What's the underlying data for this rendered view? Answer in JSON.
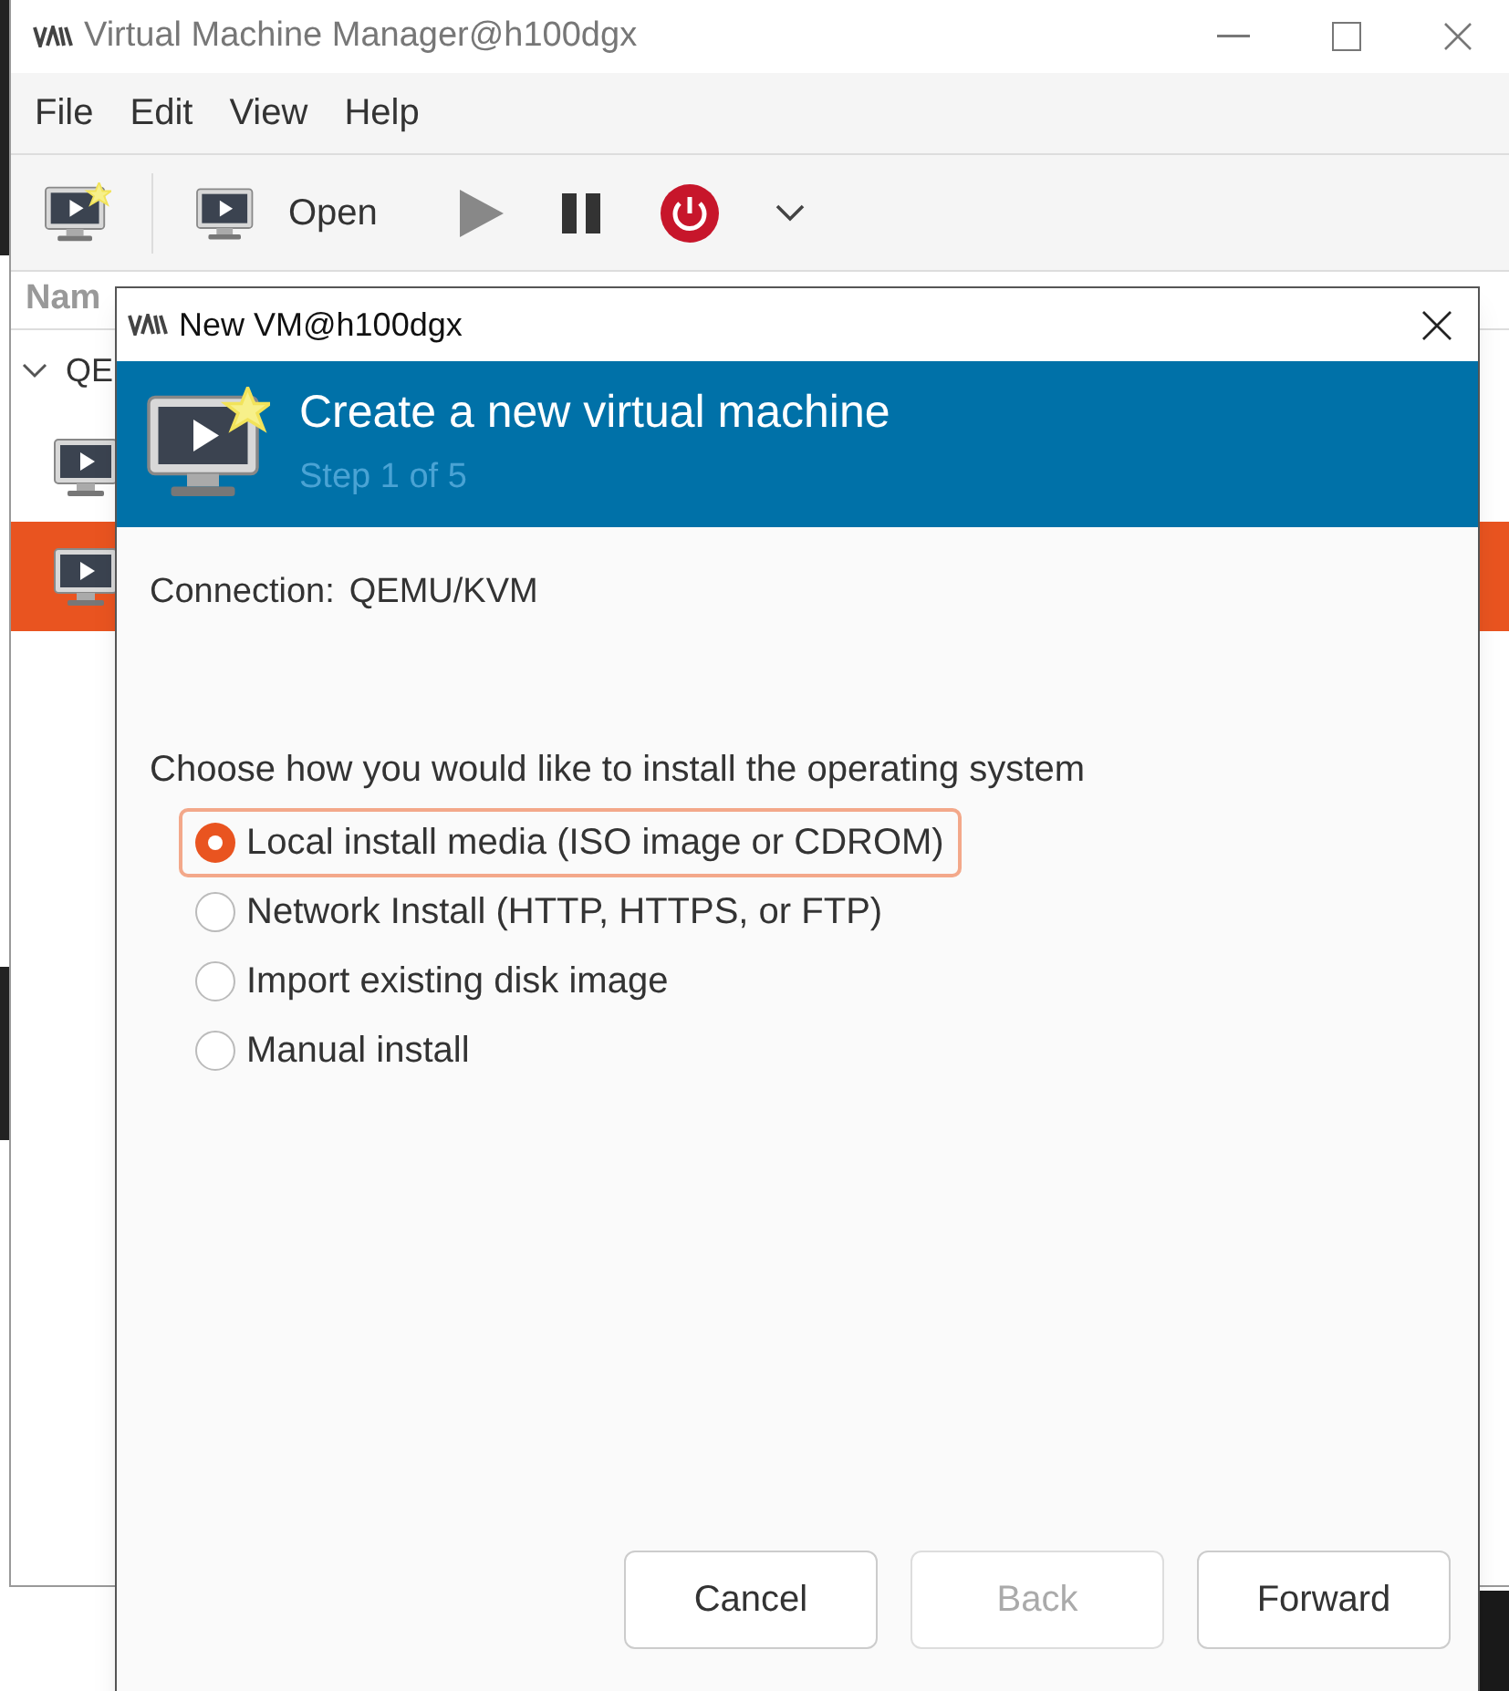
{
  "main_window": {
    "title": "Virtual Machine Manager@h100dgx",
    "menu": [
      "File",
      "Edit",
      "View",
      "Help"
    ],
    "toolbar": {
      "open_label": "Open"
    },
    "list": {
      "column_1": "Nam",
      "group": {
        "label": "QE",
        "expanded": true
      },
      "rows": [
        {
          "selected": false
        },
        {
          "selected": true
        }
      ]
    }
  },
  "dialog": {
    "title": "New VM@h100dgx",
    "header": {
      "title": "Create a new virtual machine",
      "subtitle": "Step 1 of 5"
    },
    "connection_label": "Connection:",
    "connection_value": "QEMU/KVM",
    "prompt": "Choose how you would like to install the operating system",
    "options": [
      {
        "label": "Local install media (ISO image or CDROM)",
        "selected": true
      },
      {
        "label": "Network Install (HTTP, HTTPS, or FTP)",
        "selected": false
      },
      {
        "label": "Import existing disk image",
        "selected": false
      },
      {
        "label": "Manual install",
        "selected": false
      }
    ],
    "buttons": [
      {
        "label": "Cancel",
        "disabled": false
      },
      {
        "label": "Back",
        "disabled": true
      },
      {
        "label": "Forward",
        "disabled": false
      }
    ]
  }
}
